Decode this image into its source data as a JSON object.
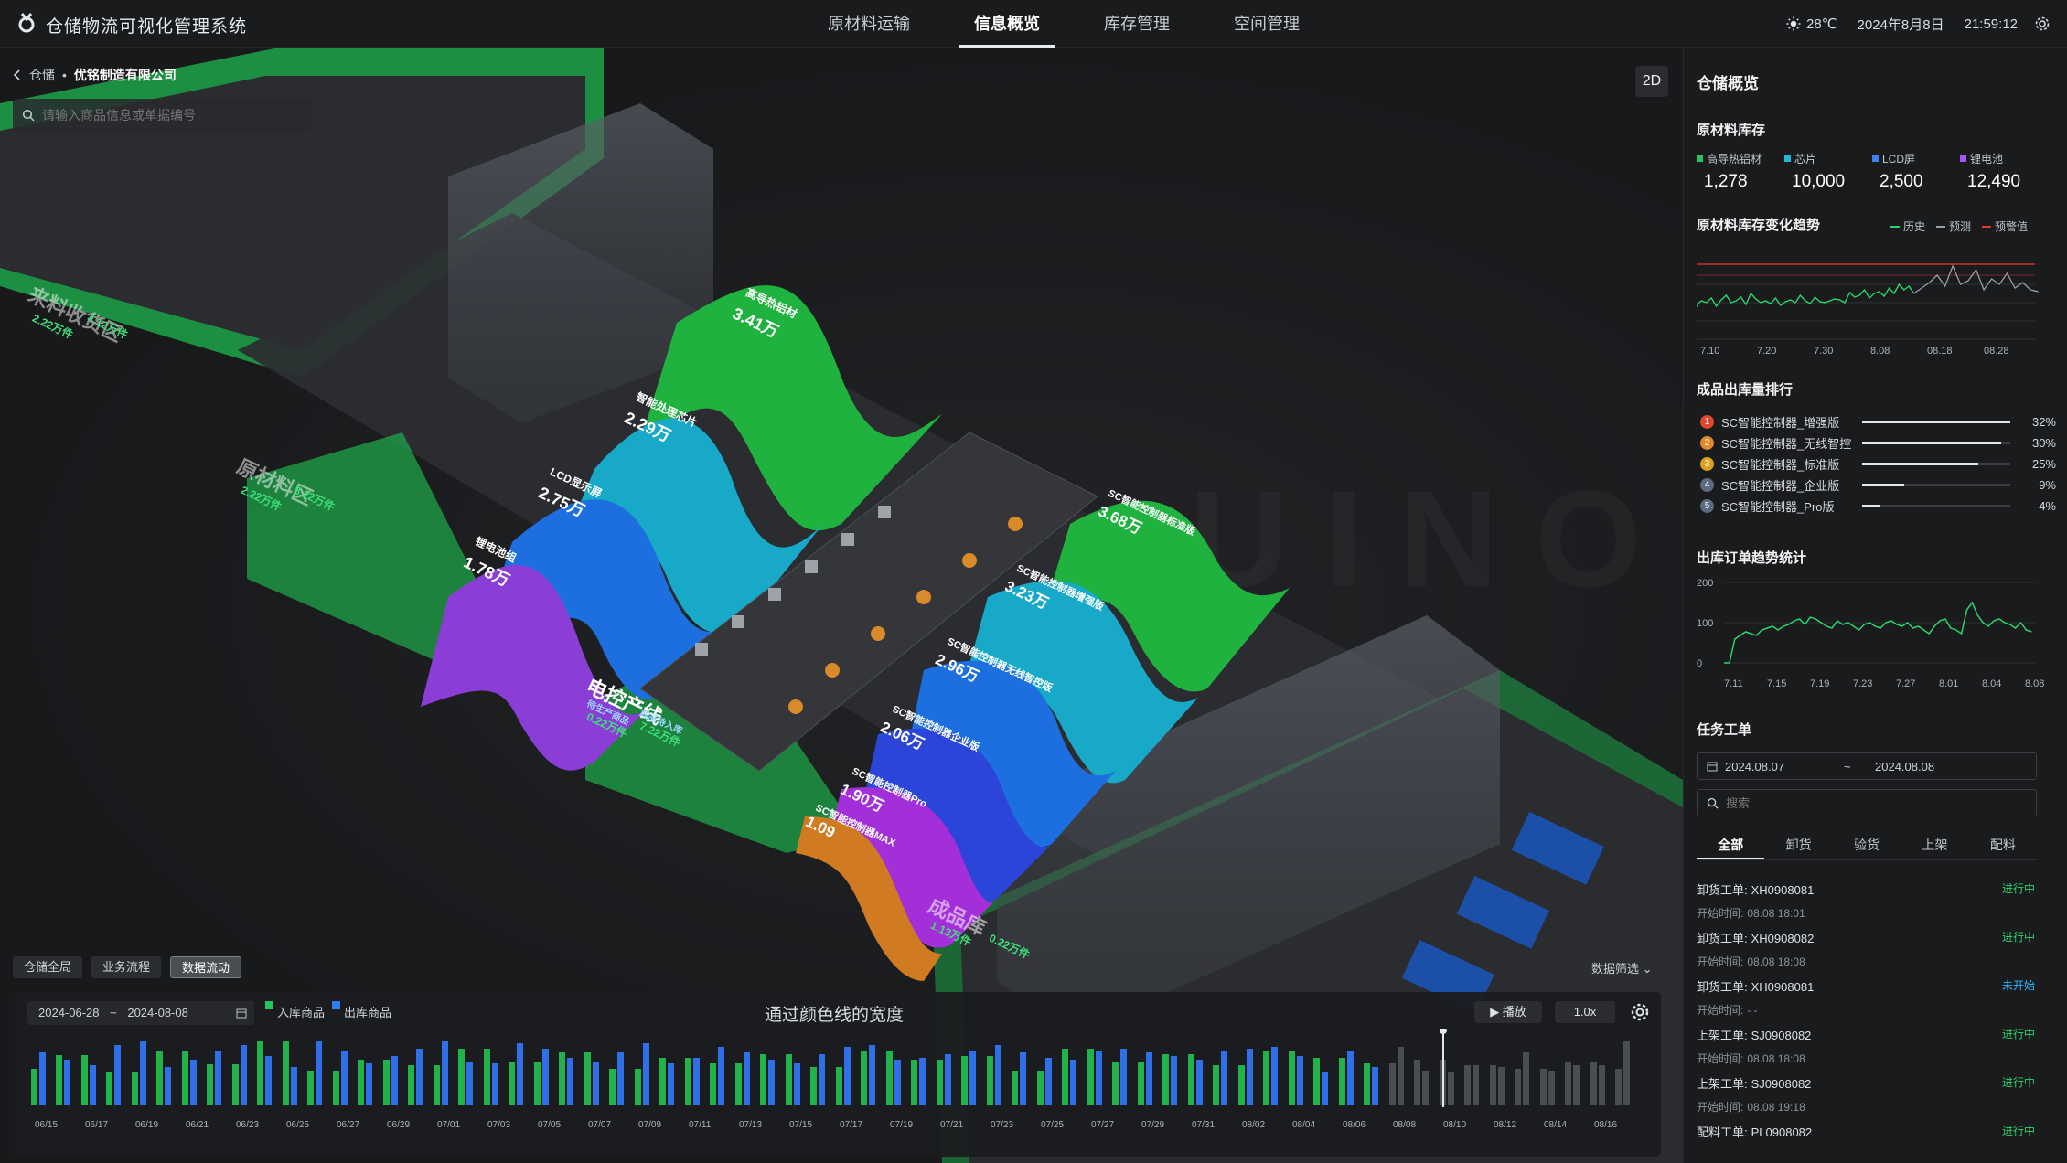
{
  "app": {
    "title": "仓储物流可视化管理系统"
  },
  "nav": {
    "items": [
      "原材料运输",
      "信息概览",
      "库存管理",
      "空间管理"
    ],
    "active_index": 1
  },
  "status": {
    "weather": "28℃",
    "date": "2024年8月8日",
    "time": "21:59:12"
  },
  "breadcrumb": {
    "root": "仓储",
    "current": "优铭制造有限公司"
  },
  "search": {
    "placeholder": "请输入商品信息或单据编号"
  },
  "view_mode_button": "2D",
  "scene_labels": {
    "zone_receiving": "来料收货区",
    "zone_material": "原材料区",
    "zone_production": "电控产线",
    "zone_finished": "成品库",
    "receiving_in": "2.22万件",
    "receiving_out": "4.12万件",
    "material_in": "2.22万件",
    "material_out": "8.22万件",
    "production_in": "0.22万件",
    "production_out": "7.22万件",
    "production_in_label": "待生产商品",
    "production_out_label": "成品待入库",
    "finished_in": "1.13万件",
    "finished_out": "0.22万件"
  },
  "flows_in": [
    {
      "name": "高导热铝材",
      "value": "3.41万",
      "color": "#1fb23f"
    },
    {
      "name": "智能处理芯片",
      "value": "2.29万",
      "color": "#18a9c8"
    },
    {
      "name": "LCD显示屏",
      "value": "2.75万",
      "color": "#1d6fe0"
    },
    {
      "name": "锂电池组",
      "value": "1.78万",
      "color": "#8a3ed6"
    }
  ],
  "flows_out": [
    {
      "name": "SC智能控制器标准版",
      "value": "3.68万",
      "color": "#1fb23f"
    },
    {
      "name": "SC智能控制器增强版",
      "value": "3.23万",
      "color": "#18a9c8"
    },
    {
      "name": "SC智能控制器无线智控版",
      "value": "2.96万",
      "color": "#1d6fe0"
    },
    {
      "name": "SC智能控制器企业版",
      "value": "2.06万",
      "color": "#2a45d8"
    },
    {
      "name": "SC智能控制器Pro",
      "value": "1.90万",
      "color": "#a22fd8"
    },
    {
      "name": "SC智能控制器MAX",
      "value": "1.09",
      "color": "#d07a22"
    }
  ],
  "view_tabs": [
    "仓储全局",
    "业务流程",
    "数据流动"
  ],
  "view_tab_active": 2,
  "data_filter": "数据筛选",
  "timeline": {
    "date_start": "2024-06-28",
    "date_end": "2024-08-08",
    "legend_in": "入库商品",
    "legend_out": "出库商品",
    "title": "通过颜色线的宽度",
    "play": "播放",
    "speed": "1.0x",
    "ticks": [
      "06/15",
      "06/17",
      "06/19",
      "06/21",
      "06/23",
      "06/25",
      "06/27",
      "06/29",
      "07/01",
      "07/03",
      "07/05",
      "07/07",
      "07/09",
      "07/11",
      "07/13",
      "07/15",
      "07/17",
      "07/19",
      "07/21",
      "07/23",
      "07/25",
      "07/27",
      "07/29",
      "07/31",
      "08/02",
      "08/04",
      "08/06",
      "08/08",
      "08/10",
      "08/12",
      "08/14",
      "08/16"
    ]
  },
  "panel": {
    "title": "仓储概览",
    "stock_title": "原材料库存",
    "stock": [
      {
        "name": "高导热铝材",
        "value": "1,278",
        "color": "#22c55e"
      },
      {
        "name": "芯片",
        "value": "10,000",
        "color": "#22b8d6"
      },
      {
        "name": "LCD屏",
        "value": "2,500",
        "color": "#3b82f6"
      },
      {
        "name": "锂电池",
        "value": "12,490",
        "color": "#a855f7"
      }
    ],
    "trend_title": "原材料库存变化趋势",
    "trend_legend": [
      "历史",
      "预测",
      "预警值"
    ],
    "trend_xticks": [
      "7.10",
      "7.20",
      "7.30",
      "8.08",
      "08.18",
      "08.28"
    ],
    "rank_title": "成品出库量排行",
    "rank": [
      {
        "name": "SC智能控制器_增强版",
        "pct": "32%",
        "value": 32,
        "color": "#e0482d"
      },
      {
        "name": "SC智能控制器_无线智控",
        "pct": "30%",
        "value": 30,
        "color": "#e08a2d"
      },
      {
        "name": "SC智能控制器_标准版",
        "pct": "25%",
        "value": 25,
        "color": "#d9a21f"
      },
      {
        "name": "SC智能控制器_企业版",
        "pct": "9%",
        "value": 9,
        "color": "#5d6b80"
      },
      {
        "name": "SC智能控制器_Pro版",
        "pct": "4%",
        "value": 4,
        "color": "#5d6b80"
      }
    ],
    "order_title": "出库订单趋势统计",
    "order_yticks": [
      "200",
      "100",
      "0"
    ],
    "order_xticks": [
      "7.11",
      "7.15",
      "7.19",
      "7.23",
      "7.27",
      "8.01",
      "8.04",
      "8.08"
    ],
    "task_title": "任务工单",
    "task_date_start": "2024.08.07",
    "task_date_end": "2024.08.08",
    "task_search_placeholder": "搜索",
    "task_tabs": [
      "全部",
      "卸货",
      "验货",
      "上架",
      "配料"
    ],
    "tasks": [
      {
        "label": "卸货工单:",
        "code": "XH0908081",
        "time_label": "开始时间:",
        "time": "08.08 18:01",
        "status": "进行中",
        "status_color": "#2bd46b"
      },
      {
        "label": "卸货工单:",
        "code": "XH0908082",
        "time_label": "开始时间:",
        "time": "08.08 18:08",
        "status": "进行中",
        "status_color": "#2bd46b"
      },
      {
        "label": "卸货工单:",
        "code": "XH0908081",
        "time_label": "开始时间:",
        "time": "- -",
        "status": "未开始",
        "status_color": "#2fb6ff"
      },
      {
        "label": "上架工单:",
        "code": "SJ0908082",
        "time_label": "开始时间:",
        "time": "08.08 18:08",
        "status": "进行中",
        "status_color": "#2bd46b"
      },
      {
        "label": "上架工单:",
        "code": "SJ0908082",
        "time_label": "开始时间:",
        "time": "08.08 19:18",
        "status": "进行中",
        "status_color": "#2bd46b"
      },
      {
        "label": "配料工单:",
        "code": "PL0908082",
        "time_label": "",
        "time": "",
        "status": "进行中",
        "status_color": "#2bd46b"
      }
    ]
  }
}
